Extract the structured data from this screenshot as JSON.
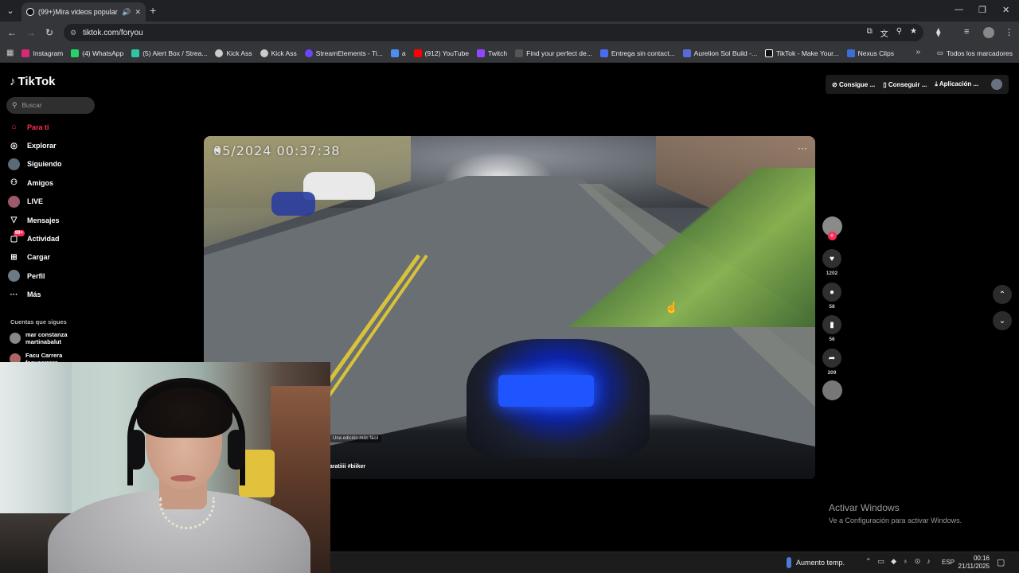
{
  "browser": {
    "tab_title": "(99+)Mira videos populares",
    "url": "tiktok.com/foryou",
    "bookmarks": [
      {
        "label": "Instagram",
        "color": "#d62976"
      },
      {
        "label": "(4) WhatsApp",
        "color": "#25d366"
      },
      {
        "label": "(5) Alert Box / Strea...",
        "color": "#31c3a2"
      },
      {
        "label": "Kick Ass",
        "color": "#cccccc"
      },
      {
        "label": "Kick Ass",
        "color": "#cccccc"
      },
      {
        "label": "StreamElements - Ti...",
        "color": "#6e44ff"
      },
      {
        "label": "a",
        "color": "#4a8ef0"
      },
      {
        "label": "(912) YouTube",
        "color": "#ff0000"
      },
      {
        "label": "Twitch",
        "color": "#9146ff"
      },
      {
        "label": "Find your perfect de...",
        "color": "#333333"
      },
      {
        "label": "Entrega sin contact...",
        "color": "#4a6cf0"
      },
      {
        "label": "Aurelion Sol Build -...",
        "color": "#5a6bd8"
      },
      {
        "label": "TikTok - Make Your...",
        "color": "#111111"
      },
      {
        "label": "Nexus Clips",
        "color": "#3b6fd6"
      }
    ],
    "all_bookmarks": "Todos los marcadores"
  },
  "tiktok": {
    "logo": "TikTok",
    "search_placeholder": "Buscar",
    "nav": [
      {
        "label": "Para ti",
        "icon": "home-icon"
      },
      {
        "label": "Explorar",
        "icon": "compass-icon"
      },
      {
        "label": "Siguiendo",
        "icon": "following-icon"
      },
      {
        "label": "Amigos",
        "icon": "friends-icon"
      },
      {
        "label": "LIVE",
        "icon": "live-icon"
      },
      {
        "label": "Mensajes",
        "icon": "messages-icon"
      },
      {
        "label": "Actividad",
        "icon": "activity-icon",
        "badge": "99+"
      },
      {
        "label": "Cargar",
        "icon": "upload-icon"
      },
      {
        "label": "Perfil",
        "icon": "profile-icon"
      },
      {
        "label": "Más",
        "icon": "more-icon"
      }
    ],
    "following_title": "Cuentas que sigues",
    "accounts": [
      {
        "name": "mar constanza",
        "handle": "martinabalut"
      },
      {
        "name": "Facu Carrera",
        "handle": "facucarrera"
      }
    ],
    "topright": {
      "btn1": "Consigue ...",
      "btn2": "Conseguir ...",
      "btn3": "Aplicación ..."
    },
    "video": {
      "timestamp": "05/2024  00:37:38",
      "tag": "Una edición más fácil",
      "caption": "aratiiii #biiker"
    },
    "actions": {
      "likes": "1202",
      "comments": "58",
      "saves": "56",
      "shares": "209"
    }
  },
  "windows": {
    "activate_title": "Activar Windows",
    "activate_sub": "Ve a Configuración para activar Windows.",
    "weather": "Aumento temp.",
    "lang": "ESP",
    "time": "00:16",
    "date": "21/11/2025"
  }
}
